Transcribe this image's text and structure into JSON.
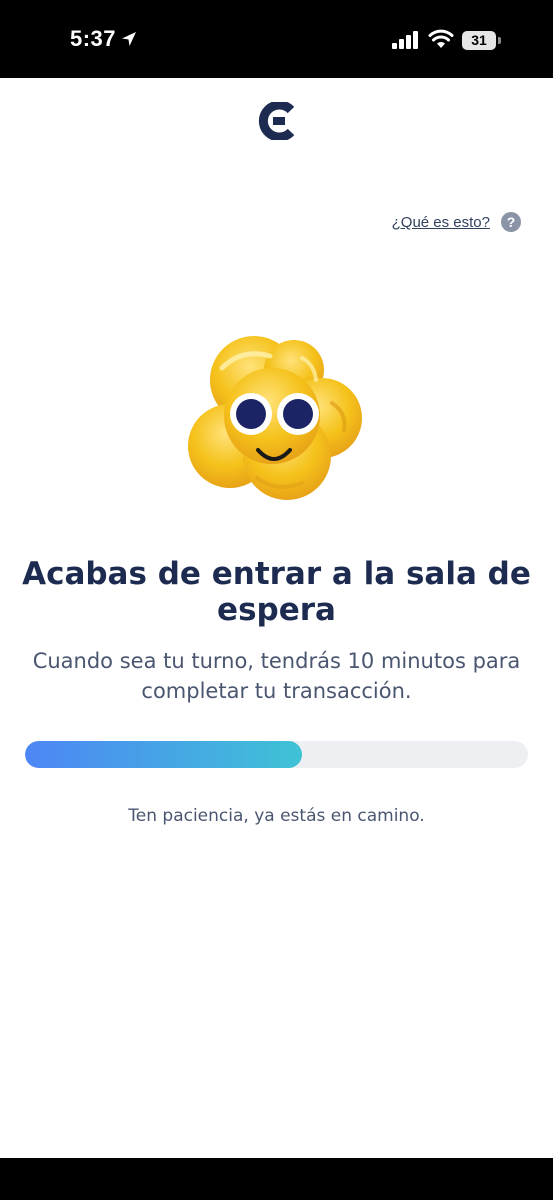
{
  "status_bar": {
    "time": "5:37",
    "battery": "31"
  },
  "header": {
    "help_link": "¿Qué es esto?",
    "help_icon_glyph": "?"
  },
  "main": {
    "title": "Acabas de entrar a la sala de espera",
    "subtitle": "Cuando sea tu turno, tendrás 10 minutos para completar tu transacción.",
    "progress_fraction": 0.55,
    "patience_text": "Ten paciencia, ya estás en camino."
  },
  "icons": {
    "location": "location-arrow-icon",
    "signal": "cellular-signal-icon",
    "wifi": "wifi-icon",
    "battery": "battery-icon",
    "logo": "brand-c-logo",
    "help": "question-icon",
    "mascot": "smiling-popcorn-mascot"
  },
  "colors": {
    "title": "#1c2b4f",
    "text": "#4a5670",
    "progress_start": "#4d86f5",
    "progress_end": "#3fc2d6",
    "progress_track": "#eeeff3",
    "mascot_yellow": "#f5c21b"
  }
}
